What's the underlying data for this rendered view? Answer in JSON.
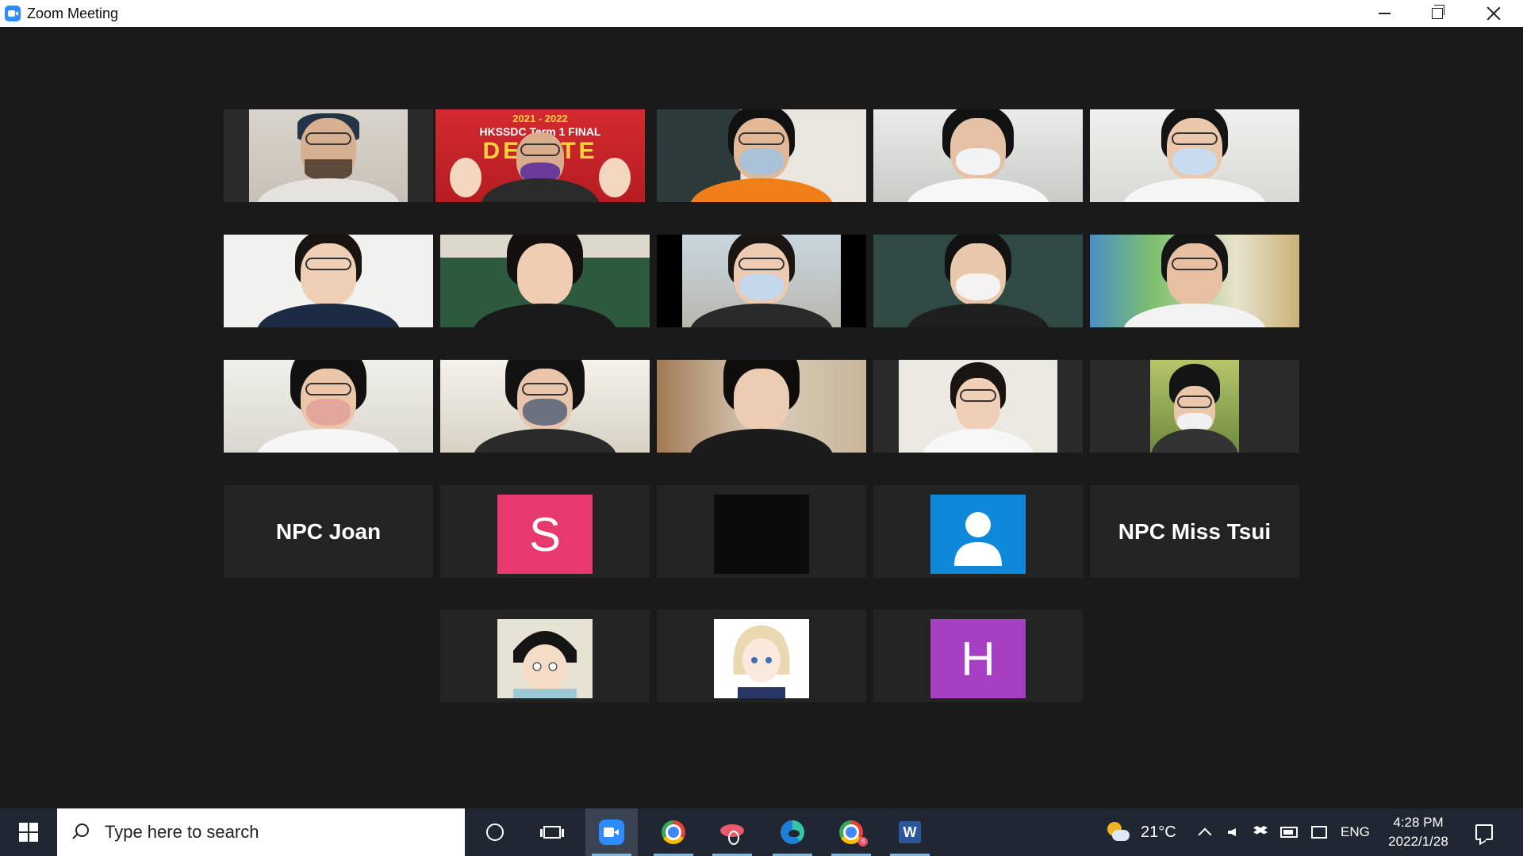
{
  "window": {
    "title": "Zoom Meeting"
  },
  "gallery": {
    "name_tiles": {
      "npc_joan": "NPC Joan",
      "npc_miss_tsui": "NPC Miss Tsui"
    },
    "avatars": {
      "s_letter": "S",
      "h_letter": "H"
    },
    "active_speaker_banner": {
      "line1": "2021 - 2022",
      "line2": "HKSSDC Term 1 FINAL",
      "line3": "DEBATE"
    },
    "colors": {
      "avatar_s": "#e8396f",
      "avatar_h": "#a63fc2",
      "avatar_default": "#0e88d9",
      "avatar_black": "#0b0b0b",
      "speaker_highlight": "#e6c34a"
    }
  },
  "taskbar": {
    "search_placeholder": "Type here to search",
    "apps": [
      "task-view",
      "zoom",
      "chrome",
      "snip-sketch",
      "edge",
      "chrome-profile",
      "word"
    ],
    "weather": {
      "temp": "21°C"
    },
    "language": "ENG",
    "clock": {
      "time": "4:28 PM",
      "date": "2022/1/28"
    }
  }
}
